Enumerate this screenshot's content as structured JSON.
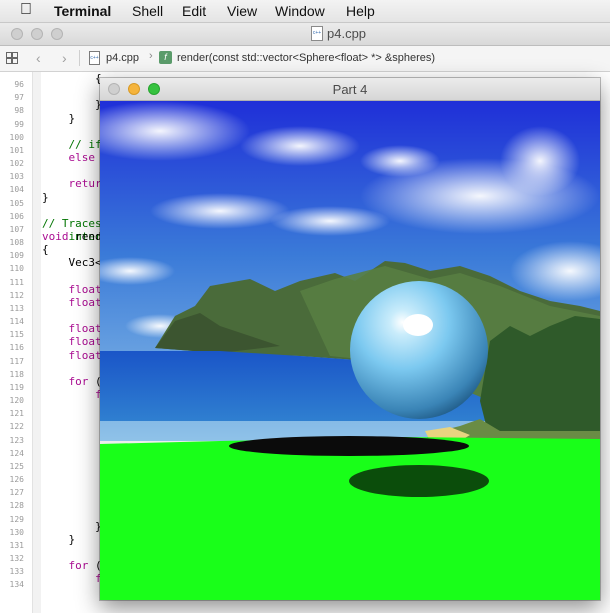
{
  "menubar": {
    "apple_icon": "apple-logo-icon",
    "items": [
      "Terminal",
      "Shell",
      "Edit",
      "View",
      "Window",
      "Help"
    ]
  },
  "xcode": {
    "title": "p4.cpp",
    "file_icon_text": "c++",
    "jump": {
      "file": "p4.cpp",
      "function": "render(const std::vector<Sphere<float> *> &spheres)"
    },
    "line_numbers": [
      "96",
      "97",
      "98",
      "99",
      "100",
      "101",
      "102",
      "103",
      "104",
      "105",
      "106",
      "107",
      "108",
      "109",
      "110",
      "111",
      "112",
      "113",
      "114",
      "115",
      "116",
      "117",
      "118",
      "119",
      "120",
      "121",
      "122",
      "123",
      "124",
      "125",
      "126",
      "127",
      "128",
      "129",
      "130",
      "131",
      "132",
      "133",
      "134"
    ],
    "code_lines": [
      {
        "n": "96",
        "parts": [
          {
            "t": "        {",
            "c": ""
          }
        ]
      },
      {
        "n": "98",
        "parts": [
          {
            "t": "        }",
            "c": ""
          }
        ]
      },
      {
        "n": "99",
        "parts": [
          {
            "t": "    }",
            "c": ""
          }
        ]
      },
      {
        "n": "101",
        "parts": [
          {
            "t": "    // if",
            "c": "cm"
          }
        ]
      },
      {
        "n": "102",
        "parts": [
          {
            "t": "    ",
            "c": ""
          },
          {
            "t": "else",
            "c": "kw"
          }
        ]
      },
      {
        "n": "104",
        "parts": [
          {
            "t": "    ",
            "c": ""
          },
          {
            "t": "retur",
            "c": "kw"
          }
        ]
      },
      {
        "n": "105",
        "parts": [
          {
            "t": "}",
            "c": ""
          }
        ]
      },
      {
        "n": "107",
        "parts": [
          {
            "t": "// Traces",
            "c": "cm"
          }
        ]
      },
      {
        "n": "107b",
        "parts": [
          {
            "t": "    inter",
            "c": "cm"
          }
        ]
      },
      {
        "n": "108",
        "parts": [
          {
            "t": "void",
            "c": "kw"
          },
          {
            "t": " rend",
            "c": ""
          }
        ]
      },
      {
        "n": "109",
        "parts": [
          {
            "t": "{",
            "c": ""
          }
        ]
      },
      {
        "n": "110",
        "parts": [
          {
            "t": "    Vec3<",
            "c": ""
          }
        ]
      },
      {
        "n": "112",
        "parts": [
          {
            "t": "    ",
            "c": ""
          },
          {
            "t": "float",
            "c": "kw"
          }
        ]
      },
      {
        "n": "113",
        "parts": [
          {
            "t": "    ",
            "c": ""
          },
          {
            "t": "float",
            "c": "kw"
          }
        ]
      },
      {
        "n": "115",
        "parts": [
          {
            "t": "    ",
            "c": ""
          },
          {
            "t": "float",
            "c": "kw"
          }
        ]
      },
      {
        "n": "116",
        "parts": [
          {
            "t": "    ",
            "c": ""
          },
          {
            "t": "float",
            "c": "kw"
          }
        ]
      },
      {
        "n": "117",
        "parts": [
          {
            "t": "    ",
            "c": ""
          },
          {
            "t": "float",
            "c": "kw"
          }
        ]
      },
      {
        "n": "119",
        "parts": [
          {
            "t": "    ",
            "c": ""
          },
          {
            "t": "for",
            "c": "kw"
          },
          {
            "t": " (",
            "c": ""
          }
        ]
      },
      {
        "n": "120",
        "parts": [
          {
            "t": "        ",
            "c": ""
          },
          {
            "t": "f",
            "c": "kw"
          }
        ]
      },
      {
        "n": "130",
        "parts": [
          {
            "t": "        }",
            "c": ""
          }
        ]
      },
      {
        "n": "131",
        "parts": [
          {
            "t": "    }",
            "c": ""
          }
        ]
      },
      {
        "n": "133",
        "parts": [
          {
            "t": "    ",
            "c": ""
          },
          {
            "t": "for",
            "c": "kw"
          },
          {
            "t": " (",
            "c": ""
          }
        ]
      },
      {
        "n": "134",
        "parts": [
          {
            "t": "        ",
            "c": ""
          },
          {
            "t": "f",
            "c": "kw"
          }
        ]
      }
    ]
  },
  "render_window": {
    "title": "Part 4",
    "scene": [
      "sky-background",
      "island-mountains",
      "ocean",
      "green-ground-plane",
      "blue-sphere",
      "black-disc",
      "disc-shadow"
    ],
    "colors": {
      "ground": "#19ff19",
      "sky_top": "#1f2fd8",
      "sphere": "#7cc9f0",
      "disc": "#0b0b0b",
      "shadow": "#0b4d0b"
    }
  }
}
